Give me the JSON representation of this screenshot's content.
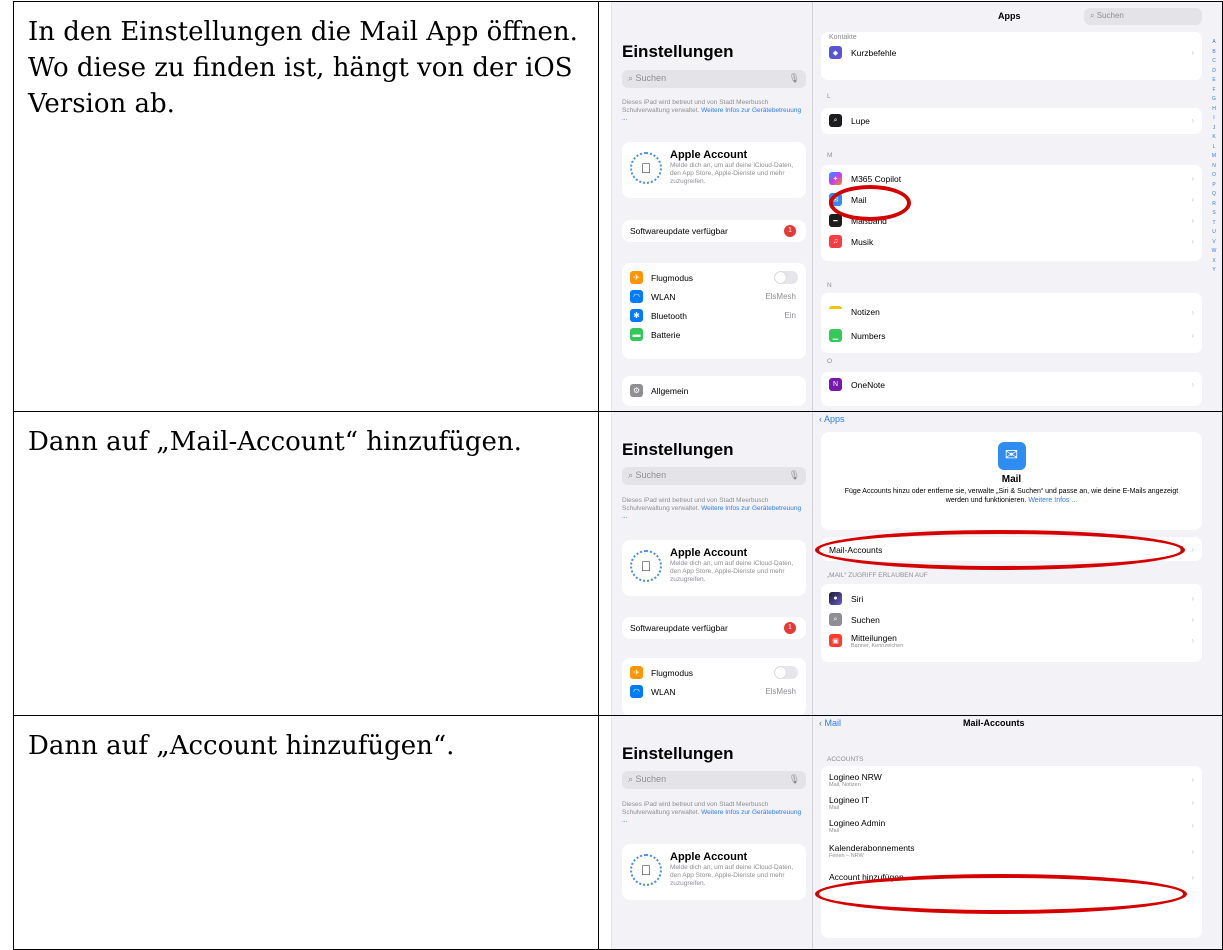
{
  "instructions": [
    "In den Einstellungen die Mail App öffnen. Wo diese zu finden ist, hängt von der iOS Version ab.",
    "Dann auf „Mail-Account“ hinzufügen.",
    "Dann auf „Account hinzufügen“."
  ],
  "settings_sidebar": {
    "title": "Einstellungen",
    "search_placeholder": "Suchen",
    "managed_note": "Dieses iPad wird betreut und von Stadt Meerbusch Schulverwaltung verwaltet.",
    "managed_link": "Weitere Infos zur Gerätebetreuung ...",
    "account_name": "Apple Account",
    "account_desc": "Melde dich an, um auf deine iCloud-Daten, den App Store, Apple-Dienste und mehr zuzugreifen.",
    "update_label": "Softwareupdate verfügbar",
    "update_badge": "1",
    "items": {
      "flugmodus": "Flugmodus",
      "wlan": "WLAN",
      "wlan_value": "ElsMesh",
      "bluetooth": "Bluetooth",
      "bluetooth_value": "Ein",
      "batterie": "Batterie",
      "allgemein": "Allgemein"
    }
  },
  "apps_list": {
    "title": "Apps",
    "search_placeholder": "Suchen",
    "partial_top": "Kontakte",
    "sections": {
      "l": "L",
      "m": "M",
      "n": "N",
      "o": "O"
    },
    "items": {
      "kurzbefehle": "Kurzbefehle",
      "lupe": "Lupe",
      "m365": "M365 Copilot",
      "mail": "Mail",
      "massband": "Maßband",
      "musik": "Musik",
      "notizen": "Notizen",
      "numbers": "Numbers",
      "onenote": "OneNote"
    },
    "index_letters": [
      "A",
      "B",
      "C",
      "D",
      "E",
      "F",
      "G",
      "H",
      "I",
      "J",
      "K",
      "L",
      "M",
      "N",
      "O",
      "P",
      "Q",
      "R",
      "S",
      "T",
      "U",
      "V",
      "W",
      "X",
      "Y"
    ]
  },
  "mail_settings": {
    "back_label": "Apps",
    "title": "Mail",
    "description": "Füge Accounts hinzu oder entferne sie, verwalte „Siri & Suchen“ und passe an, wie deine E-Mails angezeigt werden und funktionieren.",
    "description_link": "Weitere Infos ...",
    "accounts_label": "Mail-Accounts",
    "accounts_count": "6",
    "access_header": "„MAIL“ ZUGRIFF ERLAUBEN AUF",
    "siri": "Siri",
    "suchen": "Suchen",
    "mitteilungen": "Mitteilungen",
    "mitteilungen_sub": "Banner, Kennzeichen"
  },
  "mail_accounts": {
    "back_label": "Mail",
    "title": "Mail-Accounts",
    "section_header": "ACCOUNTS",
    "accounts": [
      {
        "name": "Logineo NRW",
        "sub": "Mail, Notizen"
      },
      {
        "name": "Logineo IT",
        "sub": "Mail"
      },
      {
        "name": "Logineo Admin",
        "sub": "Mail"
      },
      {
        "name": "Kalenderabonnements",
        "sub": "Ferien – NRW"
      }
    ],
    "add_label": "Account hinzufügen"
  },
  "colors": {
    "highlight": "#d50000",
    "ios_blue": "#2f7bf6"
  }
}
